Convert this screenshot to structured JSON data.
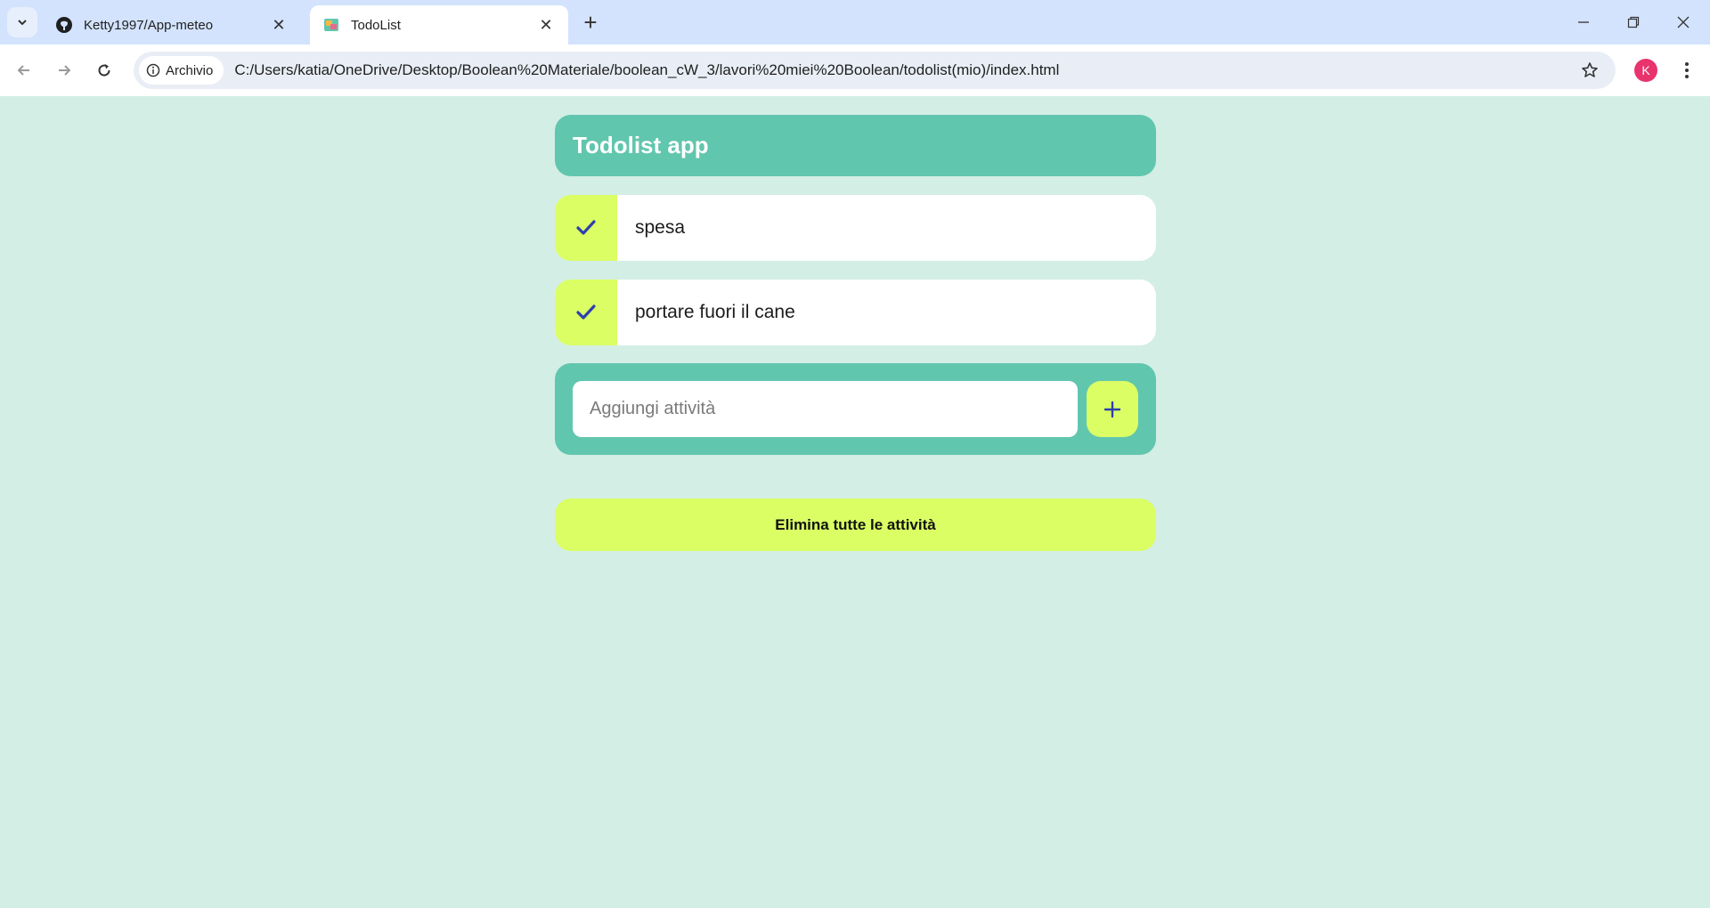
{
  "browser": {
    "tabs": [
      {
        "title": "Ketty1997/App-meteo",
        "icon": "github-icon",
        "active": false
      },
      {
        "title": "TodoList",
        "icon": "todolist-favicon",
        "active": true
      }
    ],
    "site_info_label": "Archivio",
    "url": "C:/Users/katia/OneDrive/Desktop/Boolean%20Materiale/boolean_cW_3/lavori%20miei%20Boolean/todolist(mio)/index.html",
    "profile_initial": "K",
    "colors": {
      "tabstrip": "#d3e3fd",
      "toolbar": "#ffffff",
      "omnibox": "#e9eef6",
      "avatar": "#e8336d"
    }
  },
  "app": {
    "title": "Todolist app",
    "todos": [
      {
        "text": "spesa",
        "done": true
      },
      {
        "text": "portare fuori il cane",
        "done": true
      }
    ],
    "input_placeholder": "Aggiungi attività",
    "clear_label": "Elimina tutte le attività",
    "colors": {
      "page_bg": "#d3eee5",
      "primary": "#61c6ae",
      "accent": "#dafe64",
      "check": "#2f3fae"
    }
  }
}
